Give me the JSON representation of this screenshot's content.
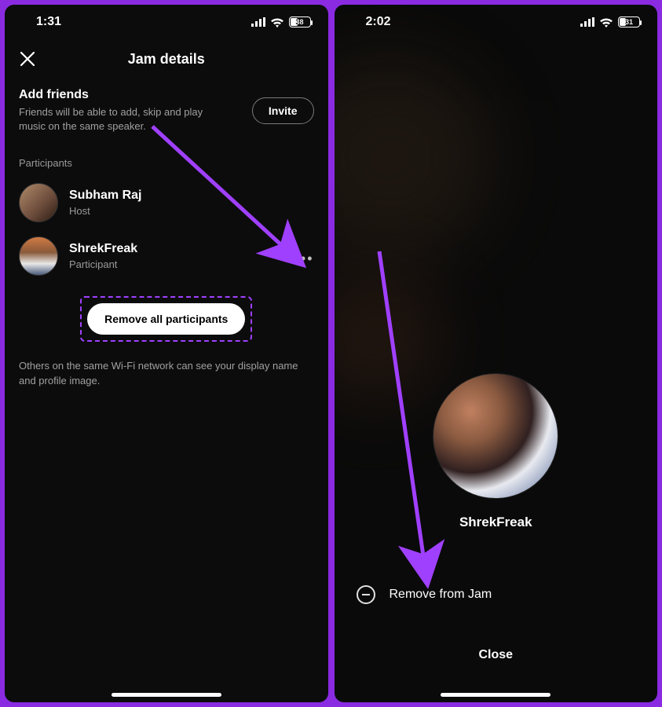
{
  "left": {
    "status": {
      "time": "1:31",
      "battery_pct": 38
    },
    "header": {
      "title": "Jam details"
    },
    "add_friends": {
      "title": "Add friends",
      "description": "Friends will be able to add, skip and play music on the same speaker.",
      "invite_label": "Invite"
    },
    "participants_heading": "Participants",
    "participants": [
      {
        "name": "Subham Raj",
        "role": "Host"
      },
      {
        "name": "ShrekFreak",
        "role": "Participant"
      }
    ],
    "remove_all_label": "Remove all participants",
    "footer_note": "Others on the same Wi-Fi network can see your display name and profile image."
  },
  "right": {
    "status": {
      "time": "2:02",
      "battery_pct": 31
    },
    "profile_name": "ShrekFreak",
    "remove_action_label": "Remove from Jam",
    "close_label": "Close"
  },
  "colors": {
    "accent_purple": "#a040ff"
  }
}
